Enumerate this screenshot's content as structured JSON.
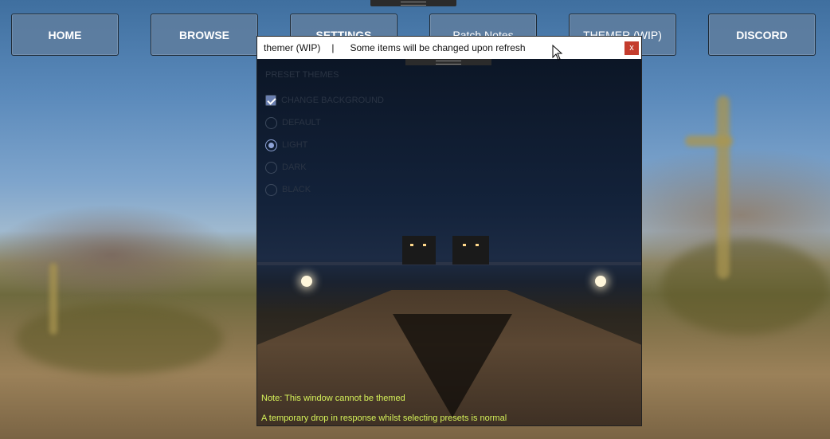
{
  "nav": {
    "home": "HOME",
    "browse": "BROWSE",
    "settings": "SETTINGS",
    "patch_notes": "Patch Notes",
    "themer": "THEMER (WIP)",
    "discord": "DISCORD"
  },
  "themer_window": {
    "title": "themer (WIP)",
    "separator": "|",
    "message": "Some items will be changed upon refresh",
    "close": "x",
    "section_label": "PRESET THEMES",
    "change_background": {
      "label": "CHANGE BACKGROUND",
      "checked": true
    },
    "presets": [
      {
        "label": "DEFAULT",
        "selected": false
      },
      {
        "label": "LIGHT",
        "selected": true
      },
      {
        "label": "DARK",
        "selected": false
      },
      {
        "label": "BLACK",
        "selected": false
      }
    ],
    "note1": "Note: This window cannot be themed",
    "note2": "A temporary drop in response whilst selecting presets is normal"
  },
  "colors": {
    "nav_button": "#5f7d9e",
    "close_button": "#c43c2d",
    "note_text": "#d6f25a",
    "radio_selected": "#8fa4d8"
  }
}
